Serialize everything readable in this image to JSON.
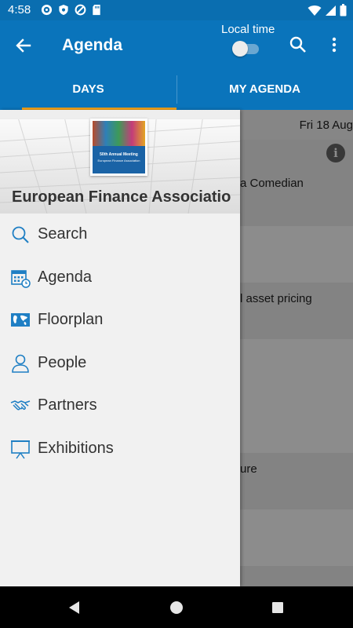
{
  "status_bar": {
    "time": "4:58",
    "icons": [
      "settings-icon",
      "shield-icon",
      "no-entry-icon",
      "sd-card-icon",
      "wifi-icon",
      "signal-icon",
      "battery-icon"
    ]
  },
  "app_bar": {
    "title": "Agenda",
    "local_time_label": "Local time",
    "local_time_enabled": false
  },
  "tabs": [
    {
      "label": "DAYS",
      "selected": true
    },
    {
      "label": "MY AGENDA",
      "selected": false
    }
  ],
  "content": {
    "date": "Fri 18 Aug",
    "rows": [
      {
        "text": "a Comedian"
      },
      {
        "text": ""
      },
      {
        "text": "l asset pricing"
      },
      {
        "text": ""
      },
      {
        "text": ""
      },
      {
        "text": "ure"
      },
      {
        "text": ""
      },
      {
        "text": ""
      }
    ]
  },
  "drawer": {
    "logo_line1": "50th Annual Meeting",
    "logo_line2": "European Finance Association",
    "organization": "European Finance Associatio..",
    "menu": [
      {
        "label": "Search",
        "icon": "search-icon"
      },
      {
        "label": "Agenda",
        "icon": "calendar-icon"
      },
      {
        "label": "Floorplan",
        "icon": "map-icon"
      },
      {
        "label": "People",
        "icon": "person-icon"
      },
      {
        "label": "Partners",
        "icon": "handshake-icon"
      },
      {
        "label": "Exhibitions",
        "icon": "easel-icon"
      }
    ]
  },
  "colors": {
    "primary": "#0a74bb",
    "status_bar": "#0a6eb0",
    "tab_indicator": "#f2a21a",
    "icon_blue": "#1f7fc4"
  }
}
